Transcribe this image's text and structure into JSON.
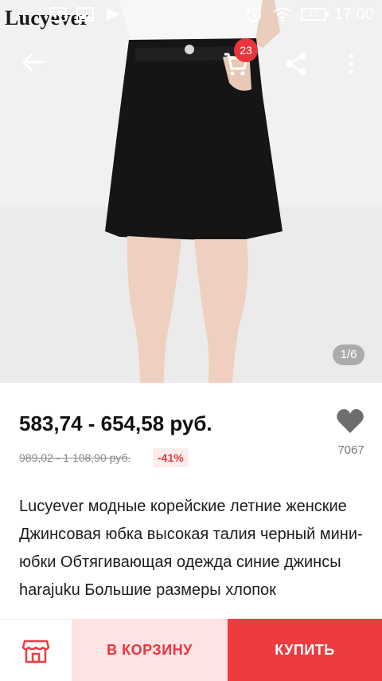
{
  "status_bar": {
    "time": "17:00",
    "battery": "18",
    "icons": [
      "calendar-icon",
      "image-icon",
      "play-icon",
      "alarm-icon",
      "wifi-icon",
      "battery-icon"
    ]
  },
  "brand": {
    "logo_text": "Lucyever"
  },
  "toolbar": {
    "cart_count": "23",
    "icons": [
      "back-arrow-icon",
      "cart-icon",
      "share-icon",
      "more-vertical-icon"
    ]
  },
  "gallery": {
    "counter": "1/6"
  },
  "product": {
    "price": "583,74 - 654,58 руб.",
    "old_price": "989,02 - 1 108,90 руб.",
    "discount": "-41%",
    "wishlist_count": "7067",
    "title": "Lucyever модные корейские летние женские Джинсовая юбка высокая талия черный мини-юбки Обтягивающая одежда синие джинсы harajuku Большие размеры хлопок"
  },
  "actions": {
    "add_to_cart": "В КОРЗИНУ",
    "buy": "КУПИТЬ"
  },
  "colors": {
    "accent": "#ee3b40",
    "accent_light": "#fde3e4",
    "badge": "#e8353c"
  }
}
